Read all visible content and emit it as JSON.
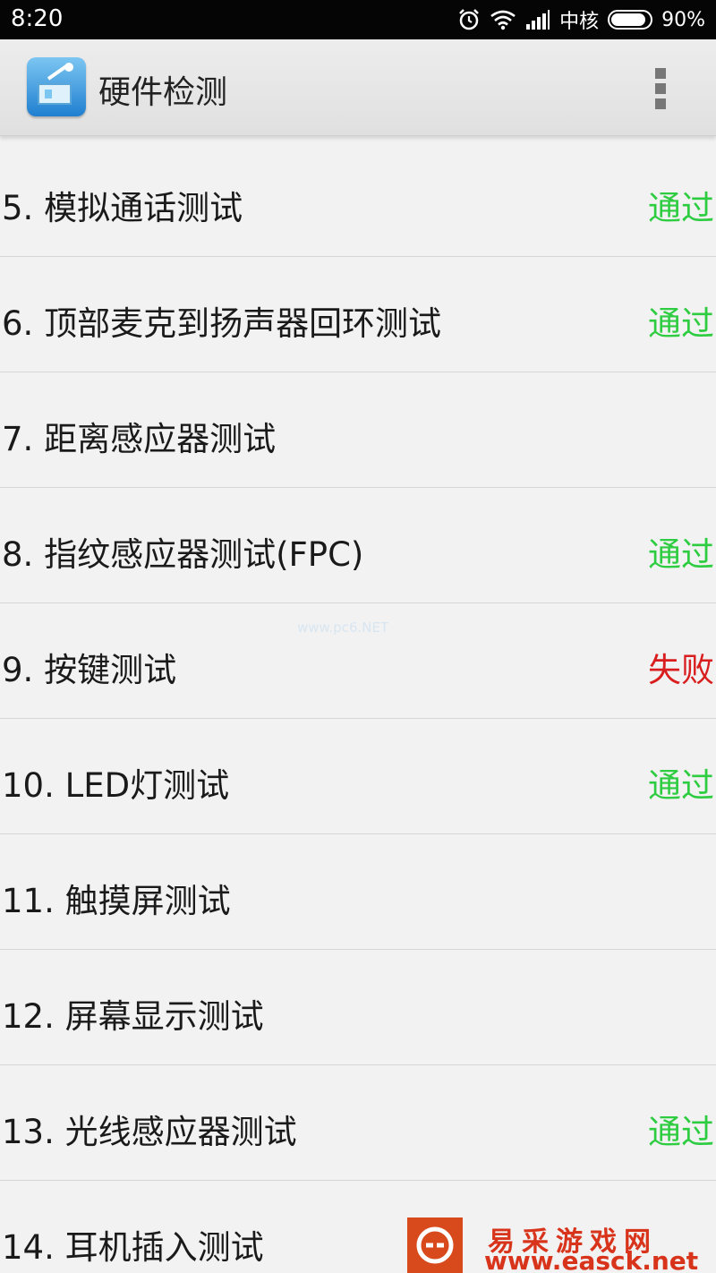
{
  "status_bar": {
    "time": "8:20",
    "carrier": "中核",
    "battery": "90%",
    "battery_level": 0.9
  },
  "action_bar": {
    "title": "硬件检测",
    "app_icon": "hardware-test-app-icon",
    "menu_icon": "overflow-menu-icon"
  },
  "colors": {
    "pass": "#2ecc40",
    "fail": "#d81e1e"
  },
  "tests": [
    {
      "label": "5. 模拟通话测试",
      "status": "通过",
      "result": "pass"
    },
    {
      "label": "6. 顶部麦克到扬声器回环测试",
      "status": "通过",
      "result": "pass"
    },
    {
      "label": "7. 距离感应器测试",
      "status": "",
      "result": "none"
    },
    {
      "label": "8. 指纹感应器测试(FPC)",
      "status": "通过",
      "result": "pass"
    },
    {
      "label": "9. 按键测试",
      "status": "失败",
      "result": "fail"
    },
    {
      "label": "10. LED灯测试",
      "status": "通过",
      "result": "pass"
    },
    {
      "label": "11. 触摸屏测试",
      "status": "",
      "result": "none"
    },
    {
      "label": "12. 屏幕显示测试",
      "status": "",
      "result": "none"
    },
    {
      "label": "13. 光线感应器测试",
      "status": "通过",
      "result": "pass"
    },
    {
      "label": "14. 耳机插入测试",
      "status": "",
      "result": "none"
    }
  ],
  "watermark": {
    "center_text": "www.pc6.NET",
    "brand_cn": "易采游戏网",
    "brand_url": "www.easck.net"
  }
}
